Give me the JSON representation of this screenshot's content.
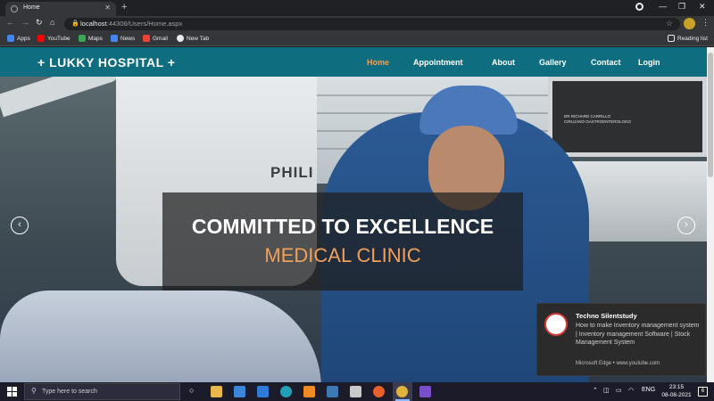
{
  "browser": {
    "tab_title": "Home",
    "url_host": "localhost",
    "url_path": ":44306/Users/Home.aspx",
    "bookmarks": [
      {
        "label": "Apps",
        "color": "#4285f4"
      },
      {
        "label": "YouTube",
        "color": "#ff0000"
      },
      {
        "label": "Maps",
        "color": "#34a853"
      },
      {
        "label": "News",
        "color": "#4285f4"
      },
      {
        "label": "Gmail",
        "color": "#ea4335"
      },
      {
        "label": "New Tab",
        "color": "#e8eaed"
      }
    ],
    "reading_list": "Reading list"
  },
  "site": {
    "brand": "+ LUKKY HOSPITAL +",
    "nav": [
      "Home",
      "Appointment",
      "About",
      "Gallery",
      "Contact",
      "Login"
    ],
    "colors": {
      "navbar": "#0e6d7e",
      "accent": "#f0a05a"
    },
    "hero": {
      "line1": "COMMITTED TO EXCELLENCE",
      "line2": "MEDICAL CLINIC",
      "machine_brand": "PHILI",
      "monitor_text": "DR RICHARD CARRILLO\nCIRUJANO GASTROENTEROLOGO"
    }
  },
  "toast": {
    "title": "Techno Silentstudy",
    "body": "How to make Inventory management system | Inventory management Software | Stock Management System",
    "source": "Microsoft Edge • www.youtube.com"
  },
  "taskbar": {
    "search_placeholder": "Type here to search",
    "lang": "ENG",
    "time": "23:15",
    "date": "08-08-2021",
    "notification_count": "6"
  }
}
